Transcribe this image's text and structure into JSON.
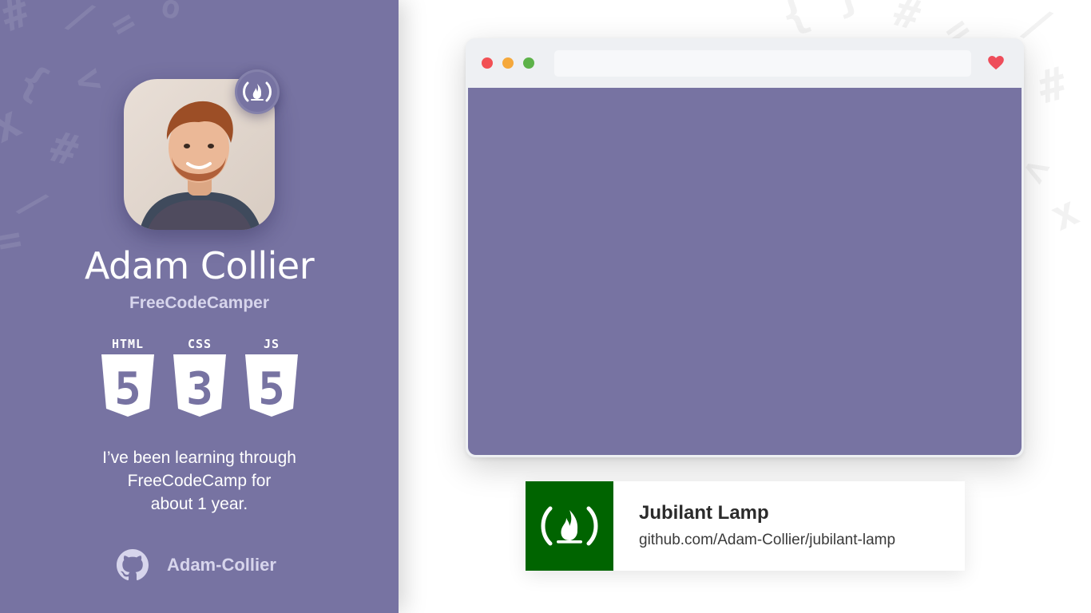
{
  "profile": {
    "name": "Adam Collier",
    "role": "FreeCodeCamper",
    "bio_lines": [
      "I’ve been learning through",
      "FreeCodeCamp for",
      "about 1 year."
    ],
    "github_handle": "Adam-Collier",
    "tech": [
      {
        "label": "HTML",
        "digit": "5",
        "icon": "html5-shield-icon"
      },
      {
        "label": "CSS",
        "digit": "3",
        "icon": "css3-shield-icon"
      },
      {
        "label": "JS",
        "digit": "5",
        "icon": "js-shield-icon"
      }
    ]
  },
  "repo": {
    "title": "Jubilant Lamp",
    "url": "github.com/Adam-Collier/jubilant-lamp"
  },
  "colors": {
    "panel": "#7773a2",
    "viewport": "#7773a2",
    "fcc_green": "#006400",
    "window_red": "#f25054",
    "window_yellow": "#f5a83b",
    "window_green": "#5db249",
    "heart": "#ee4d5a"
  }
}
